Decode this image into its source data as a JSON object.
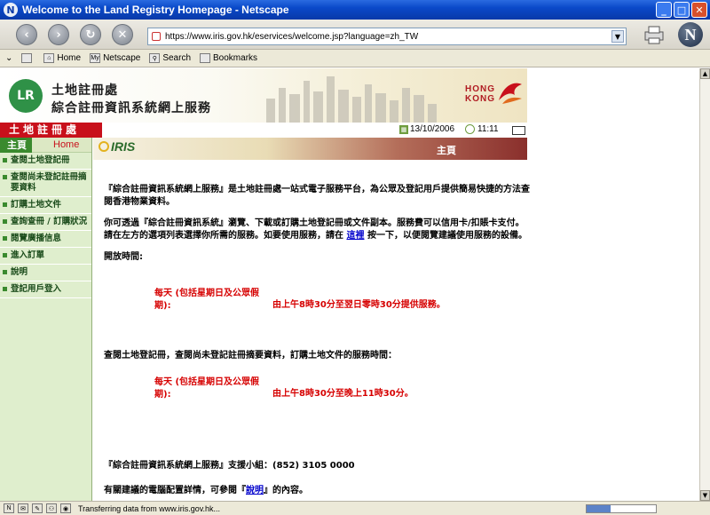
{
  "window": {
    "title": "Welcome to the Land Registry Homepage - Netscape"
  },
  "navbar": {
    "url": "https://www.iris.gov.hk/eservices/welcome.jsp?language=zh_TW"
  },
  "personal_toolbar": {
    "items": [
      {
        "label": "Home",
        "icon": "home-icon"
      },
      {
        "label": "Netscape",
        "icon": "my-netscape-icon"
      },
      {
        "label": "Search",
        "icon": "search-icon"
      },
      {
        "label": "Bookmarks",
        "icon": "bookmarks-icon"
      }
    ]
  },
  "header": {
    "title_line1": "土地註冊處",
    "title_line2": "綜合註冊資訊系統網上服務",
    "hk_brand": "HONG KONG",
    "dept_bar": "土地註冊處",
    "date": "13/10/2006",
    "time": "11:11"
  },
  "leftmenu": {
    "home_zh": "主頁",
    "home_en": "Home",
    "items": [
      "查閱土地登記冊",
      "查閱尚未登記註冊摘要資料",
      "訂購土地文件",
      "查詢查冊 / 訂購狀況",
      "閱覽廣播信息",
      "進入訂單",
      "說明",
      "登記用戶登入"
    ]
  },
  "iris_banner": {
    "logo": "IRIS",
    "section": "主頁"
  },
  "content": {
    "p1": "『綜合註冊資訊系統網上服務』是土地註冊處一站式電子服務平台，為公眾及登記用戶提供簡易快捷的方法查閱香港物業資料。",
    "p2_before": "你可透過『綜合註冊資訊系統』瀏覽、下載或訂購土地登記冊或文件副本。服務費可以信用卡/扣賬卡支付。請在左方的選項列表選擇你所需的服務。如要使用服務，請在 ",
    "p2_link": "這裡",
    "p2_after": " 按一下，以便閱覽建議使用服務的設備。",
    "open_hours_label": "開放時間:",
    "hours1_days": "每天 (包括星期日及公眾假期):",
    "hours1_time": "由上午8時30分至翌日零時30分提供服務。",
    "service_hours_label": "查閱土地登記冊，查閱尚未登記註冊摘要資料，訂購土地文件的服務時間：",
    "hours2_days": "每天 (包括星期日及公眾假期):",
    "hours2_time": "由上午8時30分至晚上11時30分。",
    "support": "『綜合註冊資訊系統網上服務』支援小組：(852) 3105 0000",
    "config_before": "有關建議的電腦配置詳情，可參閱『",
    "config_link": "說明",
    "config_after": "』的內容。"
  },
  "statusbar": {
    "text": "Transferring data from www.iris.gov.hk...",
    "progress": 0.35
  }
}
